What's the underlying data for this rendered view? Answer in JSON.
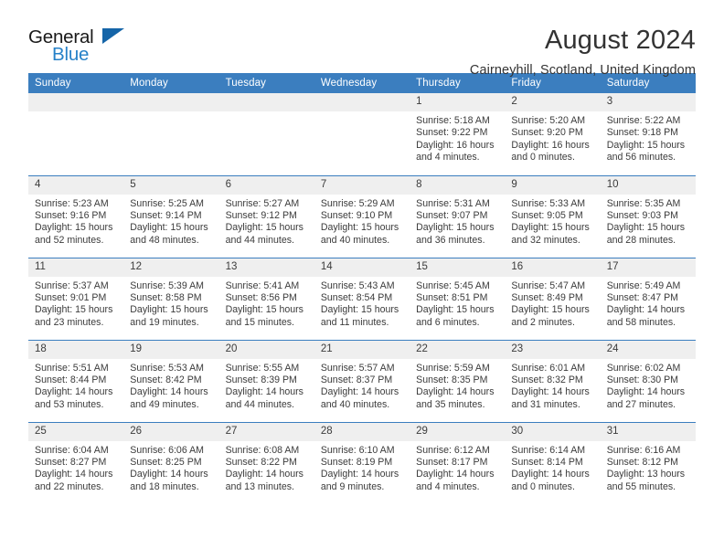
{
  "brand": {
    "name_part1": "General",
    "name_part2": "Blue",
    "triangle_color": "#1565a8",
    "blue_color": "#2681c8"
  },
  "header": {
    "title": "August 2024",
    "subtitle": "Cairneyhill, Scotland, United Kingdom",
    "header_bg": "#3b7ebf",
    "daynum_bg": "#efefef"
  },
  "weekdays": [
    "Sunday",
    "Monday",
    "Tuesday",
    "Wednesday",
    "Thursday",
    "Friday",
    "Saturday"
  ],
  "days": [
    {
      "num": "",
      "l1": "",
      "l2": "",
      "l3": "",
      "l4": ""
    },
    {
      "num": "",
      "l1": "",
      "l2": "",
      "l3": "",
      "l4": ""
    },
    {
      "num": "",
      "l1": "",
      "l2": "",
      "l3": "",
      "l4": ""
    },
    {
      "num": "",
      "l1": "",
      "l2": "",
      "l3": "",
      "l4": ""
    },
    {
      "num": "1",
      "l1": "Sunrise: 5:18 AM",
      "l2": "Sunset: 9:22 PM",
      "l3": "Daylight: 16 hours",
      "l4": "and 4 minutes."
    },
    {
      "num": "2",
      "l1": "Sunrise: 5:20 AM",
      "l2": "Sunset: 9:20 PM",
      "l3": "Daylight: 16 hours",
      "l4": "and 0 minutes."
    },
    {
      "num": "3",
      "l1": "Sunrise: 5:22 AM",
      "l2": "Sunset: 9:18 PM",
      "l3": "Daylight: 15 hours",
      "l4": "and 56 minutes."
    },
    {
      "num": "4",
      "l1": "Sunrise: 5:23 AM",
      "l2": "Sunset: 9:16 PM",
      "l3": "Daylight: 15 hours",
      "l4": "and 52 minutes."
    },
    {
      "num": "5",
      "l1": "Sunrise: 5:25 AM",
      "l2": "Sunset: 9:14 PM",
      "l3": "Daylight: 15 hours",
      "l4": "and 48 minutes."
    },
    {
      "num": "6",
      "l1": "Sunrise: 5:27 AM",
      "l2": "Sunset: 9:12 PM",
      "l3": "Daylight: 15 hours",
      "l4": "and 44 minutes."
    },
    {
      "num": "7",
      "l1": "Sunrise: 5:29 AM",
      "l2": "Sunset: 9:10 PM",
      "l3": "Daylight: 15 hours",
      "l4": "and 40 minutes."
    },
    {
      "num": "8",
      "l1": "Sunrise: 5:31 AM",
      "l2": "Sunset: 9:07 PM",
      "l3": "Daylight: 15 hours",
      "l4": "and 36 minutes."
    },
    {
      "num": "9",
      "l1": "Sunrise: 5:33 AM",
      "l2": "Sunset: 9:05 PM",
      "l3": "Daylight: 15 hours",
      "l4": "and 32 minutes."
    },
    {
      "num": "10",
      "l1": "Sunrise: 5:35 AM",
      "l2": "Sunset: 9:03 PM",
      "l3": "Daylight: 15 hours",
      "l4": "and 28 minutes."
    },
    {
      "num": "11",
      "l1": "Sunrise: 5:37 AM",
      "l2": "Sunset: 9:01 PM",
      "l3": "Daylight: 15 hours",
      "l4": "and 23 minutes."
    },
    {
      "num": "12",
      "l1": "Sunrise: 5:39 AM",
      "l2": "Sunset: 8:58 PM",
      "l3": "Daylight: 15 hours",
      "l4": "and 19 minutes."
    },
    {
      "num": "13",
      "l1": "Sunrise: 5:41 AM",
      "l2": "Sunset: 8:56 PM",
      "l3": "Daylight: 15 hours",
      "l4": "and 15 minutes."
    },
    {
      "num": "14",
      "l1": "Sunrise: 5:43 AM",
      "l2": "Sunset: 8:54 PM",
      "l3": "Daylight: 15 hours",
      "l4": "and 11 minutes."
    },
    {
      "num": "15",
      "l1": "Sunrise: 5:45 AM",
      "l2": "Sunset: 8:51 PM",
      "l3": "Daylight: 15 hours",
      "l4": "and 6 minutes."
    },
    {
      "num": "16",
      "l1": "Sunrise: 5:47 AM",
      "l2": "Sunset: 8:49 PM",
      "l3": "Daylight: 15 hours",
      "l4": "and 2 minutes."
    },
    {
      "num": "17",
      "l1": "Sunrise: 5:49 AM",
      "l2": "Sunset: 8:47 PM",
      "l3": "Daylight: 14 hours",
      "l4": "and 58 minutes."
    },
    {
      "num": "18",
      "l1": "Sunrise: 5:51 AM",
      "l2": "Sunset: 8:44 PM",
      "l3": "Daylight: 14 hours",
      "l4": "and 53 minutes."
    },
    {
      "num": "19",
      "l1": "Sunrise: 5:53 AM",
      "l2": "Sunset: 8:42 PM",
      "l3": "Daylight: 14 hours",
      "l4": "and 49 minutes."
    },
    {
      "num": "20",
      "l1": "Sunrise: 5:55 AM",
      "l2": "Sunset: 8:39 PM",
      "l3": "Daylight: 14 hours",
      "l4": "and 44 minutes."
    },
    {
      "num": "21",
      "l1": "Sunrise: 5:57 AM",
      "l2": "Sunset: 8:37 PM",
      "l3": "Daylight: 14 hours",
      "l4": "and 40 minutes."
    },
    {
      "num": "22",
      "l1": "Sunrise: 5:59 AM",
      "l2": "Sunset: 8:35 PM",
      "l3": "Daylight: 14 hours",
      "l4": "and 35 minutes."
    },
    {
      "num": "23",
      "l1": "Sunrise: 6:01 AM",
      "l2": "Sunset: 8:32 PM",
      "l3": "Daylight: 14 hours",
      "l4": "and 31 minutes."
    },
    {
      "num": "24",
      "l1": "Sunrise: 6:02 AM",
      "l2": "Sunset: 8:30 PM",
      "l3": "Daylight: 14 hours",
      "l4": "and 27 minutes."
    },
    {
      "num": "25",
      "l1": "Sunrise: 6:04 AM",
      "l2": "Sunset: 8:27 PM",
      "l3": "Daylight: 14 hours",
      "l4": "and 22 minutes."
    },
    {
      "num": "26",
      "l1": "Sunrise: 6:06 AM",
      "l2": "Sunset: 8:25 PM",
      "l3": "Daylight: 14 hours",
      "l4": "and 18 minutes."
    },
    {
      "num": "27",
      "l1": "Sunrise: 6:08 AM",
      "l2": "Sunset: 8:22 PM",
      "l3": "Daylight: 14 hours",
      "l4": "and 13 minutes."
    },
    {
      "num": "28",
      "l1": "Sunrise: 6:10 AM",
      "l2": "Sunset: 8:19 PM",
      "l3": "Daylight: 14 hours",
      "l4": "and 9 minutes."
    },
    {
      "num": "29",
      "l1": "Sunrise: 6:12 AM",
      "l2": "Sunset: 8:17 PM",
      "l3": "Daylight: 14 hours",
      "l4": "and 4 minutes."
    },
    {
      "num": "30",
      "l1": "Sunrise: 6:14 AM",
      "l2": "Sunset: 8:14 PM",
      "l3": "Daylight: 14 hours",
      "l4": "and 0 minutes."
    },
    {
      "num": "31",
      "l1": "Sunrise: 6:16 AM",
      "l2": "Sunset: 8:12 PM",
      "l3": "Daylight: 13 hours",
      "l4": "and 55 minutes."
    }
  ]
}
